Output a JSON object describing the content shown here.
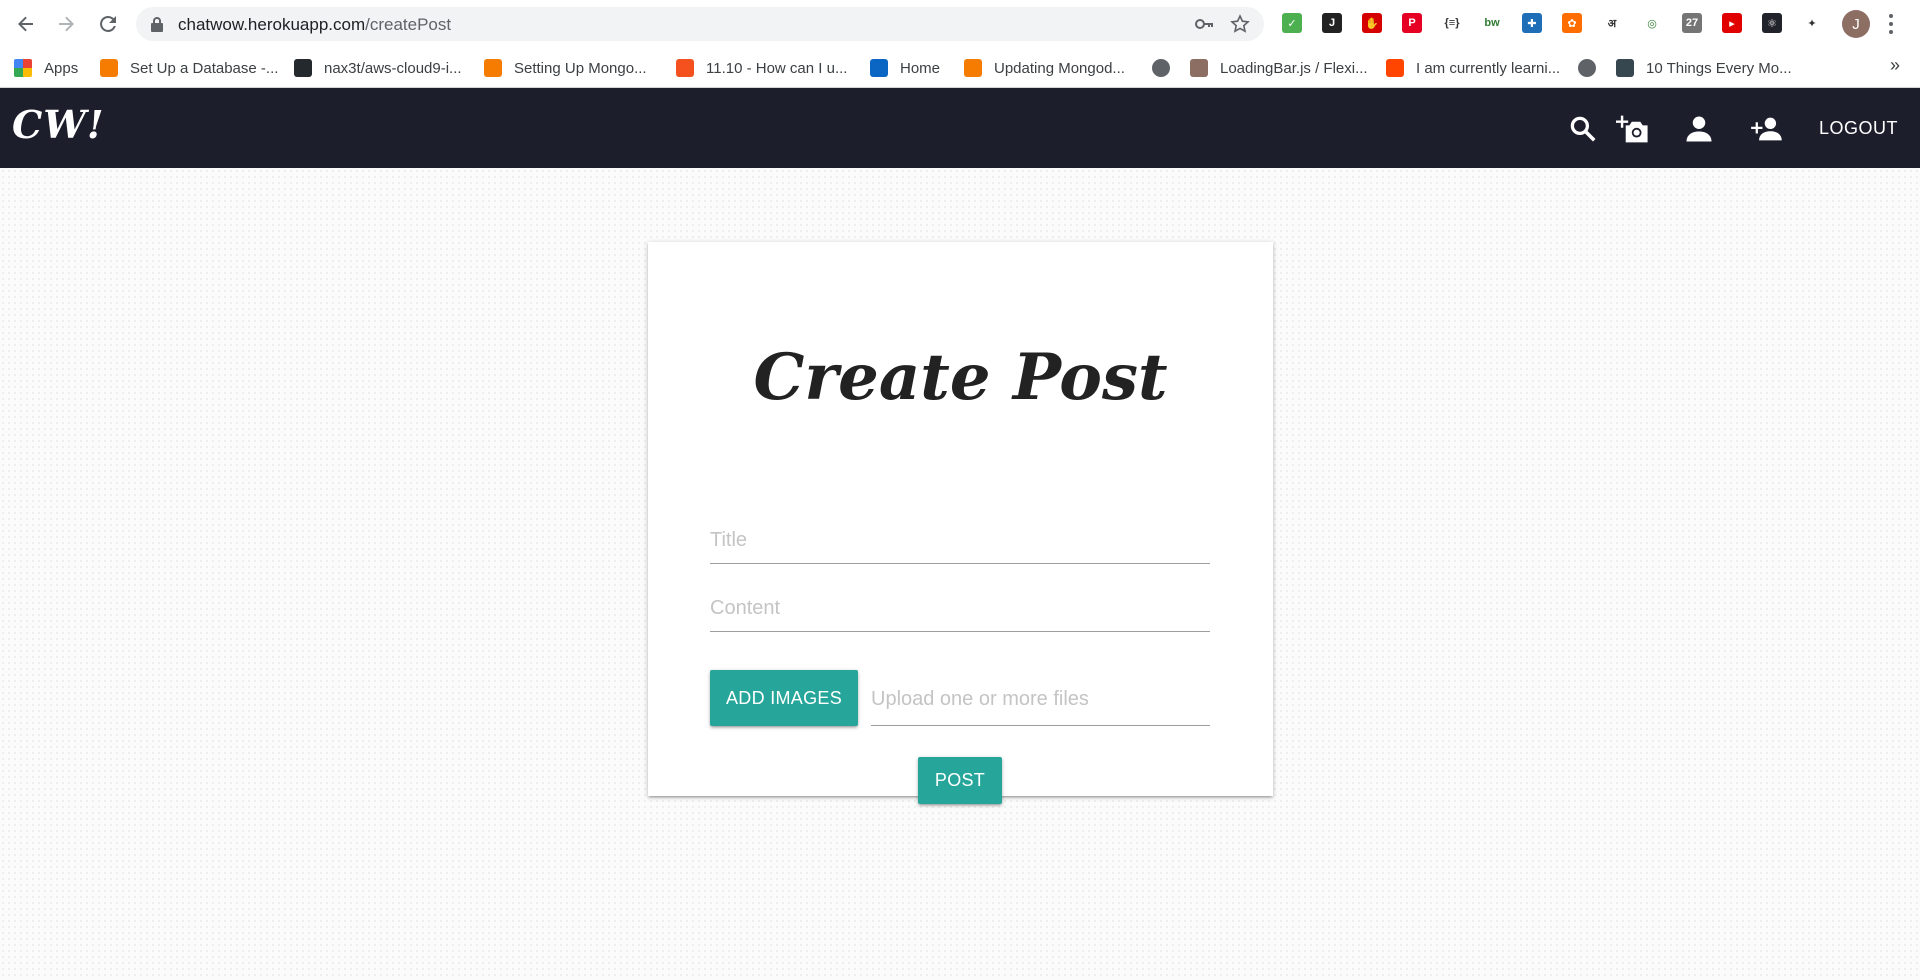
{
  "browser": {
    "url_host": "chatwow.herokuapp.com",
    "url_path": "/createPost",
    "nav": {
      "back": "←",
      "forward": "→",
      "reload": "↻"
    },
    "extensions": [
      {
        "name": "ext-1-icon",
        "color": "#4caf50",
        "glyph": "✓"
      },
      {
        "name": "ext-2-icon",
        "color": "#222222",
        "glyph": "J"
      },
      {
        "name": "ext-3-icon",
        "color": "#d50000",
        "glyph": "✋"
      },
      {
        "name": "pinterest-icon",
        "color": "#e60023",
        "glyph": "P"
      },
      {
        "name": "json-icon",
        "color": "#ffffff",
        "glyph": "{≡}"
      },
      {
        "name": "bw-icon",
        "color": "#ffffff",
        "glyph": "bw"
      },
      {
        "name": "ext-7-icon",
        "color": "#1e6fb8",
        "glyph": "✚"
      },
      {
        "name": "ext-8-icon",
        "color": "#ff6d00",
        "glyph": "✿"
      },
      {
        "name": "hindi-icon",
        "color": "#ffffff",
        "glyph": "अ"
      },
      {
        "name": "ext-10-icon",
        "color": "#e0e0e0",
        "glyph": "◎"
      },
      {
        "name": "ext-11-icon",
        "color": "#757575",
        "glyph": "27"
      },
      {
        "name": "youtube-icon",
        "color": "#e00000",
        "glyph": "▸"
      },
      {
        "name": "react-icon",
        "color": "#20232a",
        "glyph": "⚛"
      },
      {
        "name": "puzzle-icon",
        "color": "#ffffff",
        "glyph": "✦"
      }
    ],
    "profile_initial": "J",
    "bookmarks": [
      {
        "label": "Apps",
        "color": "#4285f4"
      },
      {
        "label": "Set Up a Database -...",
        "color": "#f57c00"
      },
      {
        "label": "nax3t/aws-cloud9-i...",
        "color": "#24292e"
      },
      {
        "label": "Setting Up Mongo...",
        "color": "#f57c00"
      },
      {
        "label": "11.10 - How can I u...",
        "color": "#f4511e"
      },
      {
        "label": "Home",
        "color": "#0a66c2"
      },
      {
        "label": "Updating Mongod...",
        "color": "#f57c00"
      },
      {
        "label": "",
        "color": "#5f6368"
      },
      {
        "label": "LoadingBar.js / Flexi...",
        "color": "#8d6e63"
      },
      {
        "label": "I am currently learni...",
        "color": "#ff4500"
      },
      {
        "label": "",
        "color": "#5f6368"
      },
      {
        "label": "10 Things Every Mo...",
        "color": "#37474f"
      }
    ],
    "more_bookmarks": "»"
  },
  "app": {
    "brand": "CW!",
    "logout_label": "LOGOUT"
  },
  "form": {
    "title": "Create Post",
    "title_placeholder": "Title",
    "content_placeholder": "Content",
    "add_images_label": "ADD IMAGES",
    "files_placeholder": "Upload one or more files",
    "post_label": "POST",
    "accent_color": "#26a69a"
  }
}
